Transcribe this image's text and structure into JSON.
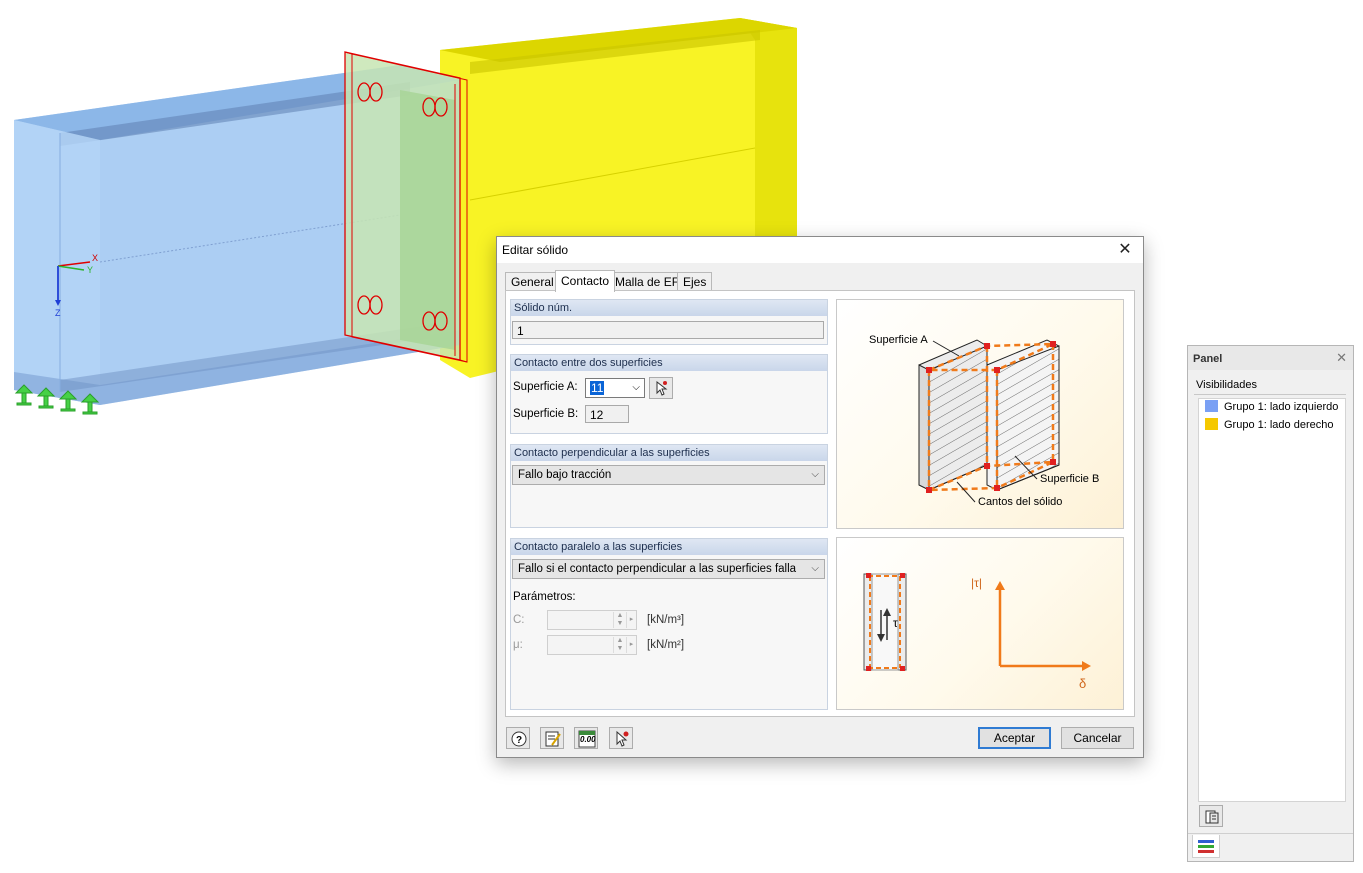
{
  "viewport": {
    "axes": {
      "x": "X",
      "y": "Y",
      "z": "Z"
    },
    "colors": {
      "left_group": "#9ec6f1",
      "right_group": "#f7f20d",
      "plate": "#b8e0a0",
      "bolts": "#e00000",
      "supports": "#46d146"
    }
  },
  "dialog": {
    "title": "Editar sólido",
    "close_icon": "close-icon",
    "tabs": [
      "General",
      "Contacto",
      "Malla de EF",
      "Ejes"
    ],
    "active_tab": "Contacto",
    "solid_no": {
      "header": "Sólido núm.",
      "value": "1"
    },
    "contact_two_surfaces": {
      "header": "Contacto entre dos superficies",
      "surface_a_label": "Superficie A:",
      "surface_a_value": "11",
      "surface_b_label": "Superficie B:",
      "surface_b_value": "12"
    },
    "perpendicular": {
      "header": "Contacto perpendicular a las superficies",
      "value": "Fallo bajo tracción"
    },
    "parallel": {
      "header": "Contacto paralelo a las superficies",
      "value": "Fallo si el contacto perpendicular a las superficies falla",
      "params_label": "Parámetros:",
      "c_label": "C:",
      "c_unit": "[kN/m³]",
      "mu_label": "μ:",
      "mu_unit": "[kN/m²]"
    },
    "figure1": {
      "surface_a": "Superficie A",
      "surface_b": "Superficie B",
      "edges": "Cantos del sólido"
    },
    "figure2": {
      "tau": "τ",
      "abs_tau": "|τ|",
      "delta": "δ"
    },
    "footer_icons": [
      "help-icon",
      "edit-icon",
      "units-icon",
      "pick-icon"
    ],
    "units_icon_text": "0.00",
    "ok": "Aceptar",
    "cancel": "Cancelar"
  },
  "panel": {
    "title": "Panel",
    "section": "Visibilidades",
    "items": [
      {
        "label": "Grupo 1: lado izquierdo",
        "color": "#7aa0f4"
      },
      {
        "label": "Grupo 1: lado derecho",
        "color": "#f5c800"
      }
    ]
  }
}
